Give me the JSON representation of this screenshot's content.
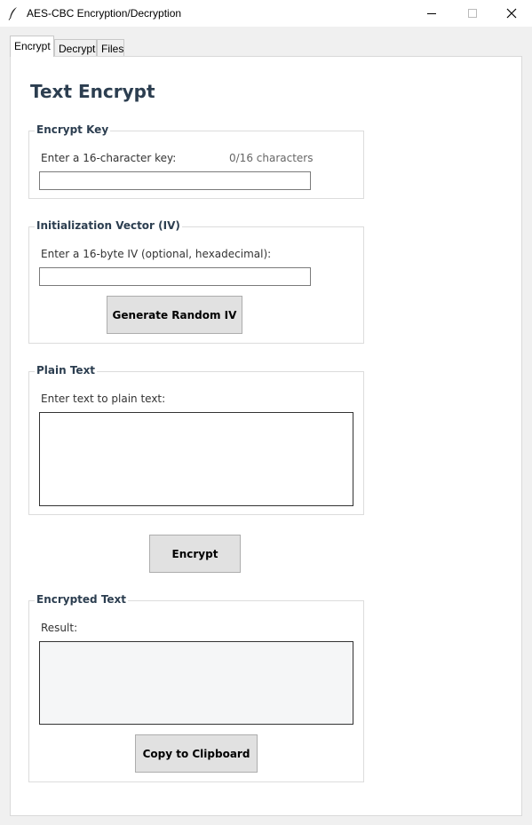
{
  "window": {
    "title": "AES-CBC Encryption/Decryption",
    "icon": "feather-icon"
  },
  "tabs": [
    {
      "label": "Encrypt",
      "active": true
    },
    {
      "label": "Decrypt",
      "active": false
    },
    {
      "label": "Files",
      "active": false
    }
  ],
  "page": {
    "heading": "Text Encrypt"
  },
  "encrypt_key": {
    "title": "Encrypt Key",
    "label": "Enter a 16-character key:",
    "counter": "0/16 characters",
    "value": ""
  },
  "iv": {
    "title": "Initialization Vector (IV)",
    "label": "Enter a 16-byte IV (optional, hexadecimal):",
    "value": "",
    "generate_button": "Generate Random IV"
  },
  "plain_text": {
    "title": "Plain Text",
    "label": "Enter text to plain text:",
    "value": ""
  },
  "actions": {
    "encrypt_button": "Encrypt"
  },
  "encrypted_text": {
    "title": "Encrypted Text",
    "label": "Result:",
    "value": "",
    "copy_button": "Copy to Clipboard"
  },
  "colors": {
    "heading": "#2c3e50",
    "button_bg": "#e1e1e1",
    "panel_bg": "#ffffff",
    "window_bg": "#f0f0f0"
  }
}
